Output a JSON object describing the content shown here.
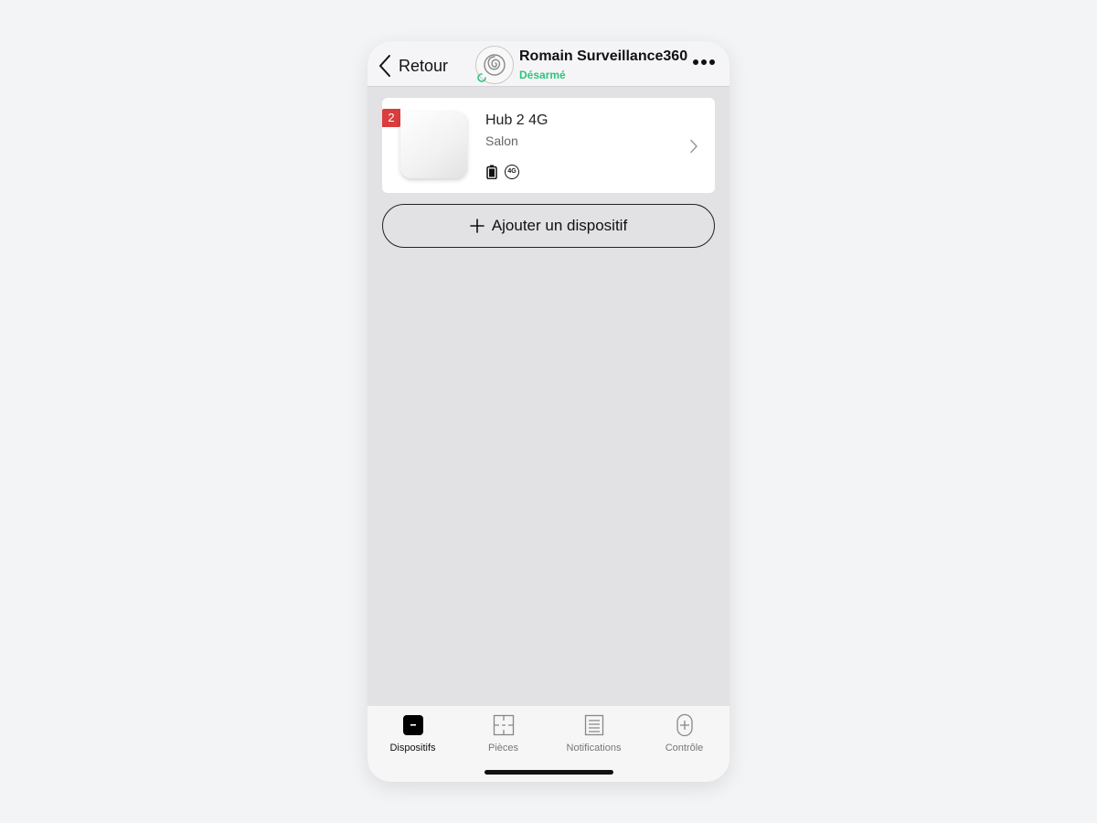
{
  "header": {
    "back_label": "Retour",
    "hub_name": "Romain Surveillance360",
    "hub_status": "Désarmé",
    "hub_status_color": "#2fc47a"
  },
  "devices": [
    {
      "badge": "2",
      "name": "Hub 2 4G",
      "room": "Salon",
      "status_icons": [
        "battery-icon",
        "4g-signal-icon"
      ],
      "icon_4g_text": "4G"
    }
  ],
  "actions": {
    "add_device_label": "Ajouter un dispositif"
  },
  "tabs": [
    {
      "label": "Dispositifs",
      "icon": "devices-icon",
      "active": true
    },
    {
      "label": "Pièces",
      "icon": "rooms-icon",
      "active": false
    },
    {
      "label": "Notifications",
      "icon": "notifications-icon",
      "active": false
    },
    {
      "label": "Contrôle",
      "icon": "control-icon",
      "active": false
    }
  ],
  "colors": {
    "badge": "#d93d3d",
    "background": "#e2e1e3"
  }
}
